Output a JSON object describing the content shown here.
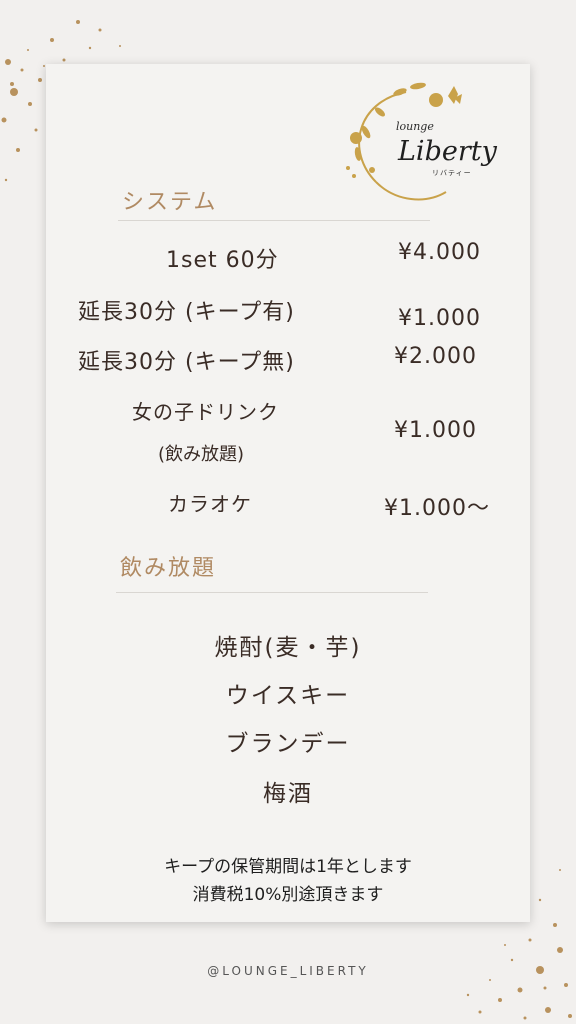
{
  "logo": {
    "small": "lounge",
    "main": "Liberty",
    "kana": "リバティー"
  },
  "system": {
    "title": "システム",
    "rows": [
      {
        "label": "1set 60分",
        "price": "¥4.000"
      },
      {
        "label": "延長30分 (キープ有)",
        "price": "¥1.000"
      },
      {
        "label": "延長30分 (キープ無)",
        "price": "¥2.000"
      },
      {
        "label": "女の子ドリンク",
        "sublabel": "(飲み放題)",
        "price": "¥1.000"
      },
      {
        "label": "カラオケ",
        "price": "¥1.000〜"
      }
    ]
  },
  "nomihoudai": {
    "title": "飲み放題",
    "items": [
      "焼酎(麦・芋)",
      "ウイスキー",
      "ブランデー",
      "梅酒"
    ]
  },
  "notes": [
    "キープの保管期間は1年とします",
    "消費税10%別途頂きます"
  ],
  "handle": "@LOUNGE_LIBERTY",
  "colors": {
    "accent": "#b08a63",
    "gold": "#c9a24a",
    "text": "#3a2c26",
    "background": "#f2f0ee"
  }
}
